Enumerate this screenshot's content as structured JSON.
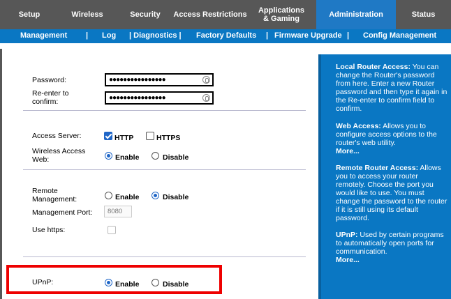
{
  "tabs": [
    {
      "label": "Setup"
    },
    {
      "label": "Wireless"
    },
    {
      "label": "Security"
    },
    {
      "label": "Access Restrictions"
    },
    {
      "line1": "Applications",
      "line2": "& Gaming"
    },
    {
      "label": "Administration"
    },
    {
      "label": "Status"
    }
  ],
  "subnav": {
    "management": "Management",
    "sep1": "|",
    "log": "Log",
    "diagnostics": "| Diagnostics |",
    "factory": "Factory Defaults",
    "sep2": "|",
    "firmware": "Firmware Upgrade",
    "sep3": "|",
    "config": "Config Management"
  },
  "form": {
    "password_label": "Password:",
    "password_value": "●●●●●●●●●●●●●●●●",
    "reenter_label_1": "Re-enter to",
    "reenter_label_2": "confirm:",
    "reenter_value": "●●●●●●●●●●●●●●●●",
    "access_server_label": "Access Server:",
    "http_label": "HTTP",
    "https_label": "HTTPS",
    "wireless_web_label_1": "Wireless Access",
    "wireless_web_label_2": "Web:",
    "enable": "Enable",
    "disable": "Disable",
    "remote_mgmt_label_1": "Remote",
    "remote_mgmt_label_2": "Management:",
    "mgmt_port_label": "Management Port:",
    "mgmt_port_value": "8080",
    "use_https_label": "Use https:",
    "upnp_label": "UPnP:"
  },
  "help": {
    "local_title": "Local Router Access:",
    "local_text": " You can change the Router's password from here. Enter a new Router password and then type it again in the Re-enter to confirm field to confirm.",
    "web_title": "Web Access:",
    "web_text": " Allows you to configure access options to the router's web utility.",
    "more": "More...",
    "remote_title": "Remote Router Access:",
    "remote_text": " Allows you to access your router remotely. Choose the port you would like to use. You must change the password to the router if it is still using its default password.",
    "upnp_title": "UPnP:",
    "upnp_text": " Used by certain programs to automatically open ports for communication."
  },
  "colors": {
    "tab_bar": "#575757",
    "accent_blue": "#0a77c3",
    "highlight_red": "#ee0000"
  }
}
